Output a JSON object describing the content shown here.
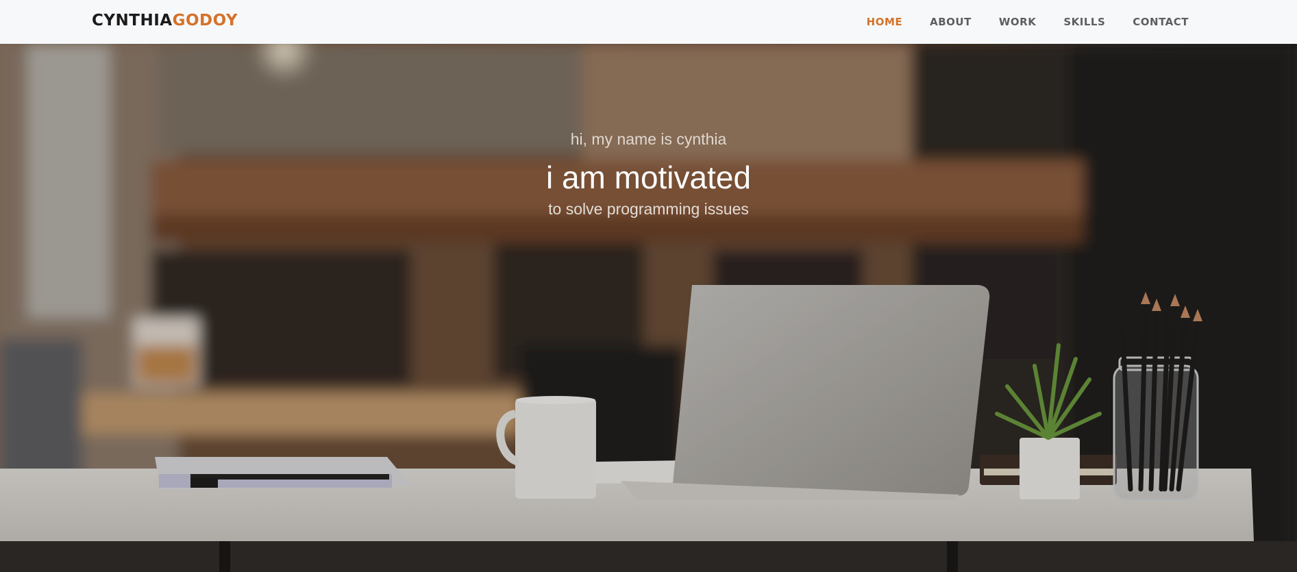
{
  "brand": {
    "first": "CYNTHIA",
    "last": "GODOY"
  },
  "nav": {
    "items": [
      {
        "label": "HOME",
        "active": true
      },
      {
        "label": "ABOUT"
      },
      {
        "label": "WORK"
      },
      {
        "label": "SKILLS"
      },
      {
        "label": "CONTACT"
      }
    ]
  },
  "hero": {
    "intro": "hi, my name is cynthia",
    "headline": "i am motivated",
    "tagline": "to solve programming issues"
  },
  "colors": {
    "accent": "#d4722a",
    "nav_bg": "#f7f8fa",
    "nav_text": "#5e5e5e"
  }
}
